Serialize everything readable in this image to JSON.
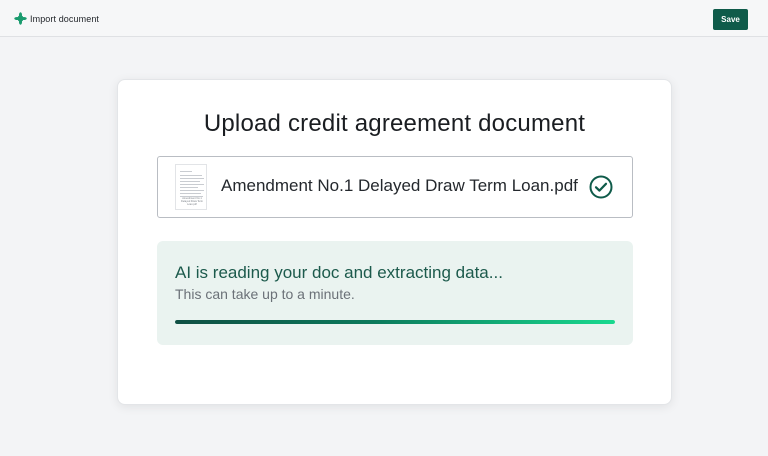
{
  "header": {
    "title": "Import document",
    "logo_icon": "sparkle-logo-icon",
    "save_label": "Save"
  },
  "card": {
    "title": "Upload credit agreement document",
    "file": {
      "name": "Amendment No.1 Delayed Draw Term Loan.pdf",
      "thumbnail_caption": "Amendment No.1 Delayed Draw Term Loan.pdf",
      "status_icon": "check-circle-icon"
    },
    "progress": {
      "title": "AI is reading your doc and extracting data...",
      "subtitle": "This can take up to a minute.",
      "value": 1.0
    }
  },
  "colors": {
    "accent": "#0f5b4a",
    "panel_bg": "#eaf3f0",
    "progress_start": "#0f4f43",
    "progress_end": "#19d98f"
  }
}
